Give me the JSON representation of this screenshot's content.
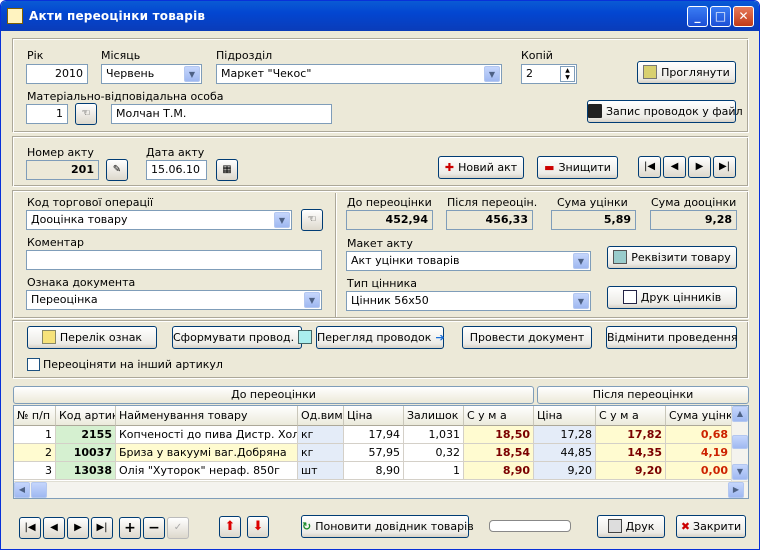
{
  "window": {
    "title": "Акти переоцінки товарів",
    "min": "_",
    "max": "□",
    "close": "✕"
  },
  "top": {
    "year_label": "Рік",
    "year": "2010",
    "month_label": "Місяць",
    "month": "Червень",
    "dept_label": "Підрозділ",
    "dept": "Маркет \"Чекос\"",
    "copies_label": "Копій",
    "copies": "2",
    "person_label": "Матеріально-відповідальна особа",
    "person_id": "1",
    "person_name": "Молчан Т.М.",
    "view_btn": "Проглянути",
    "save_btn": "Запис проводок у файл"
  },
  "act": {
    "number_label": "Номер акту",
    "number": "201",
    "date_label": "Дата акту",
    "date": "15.06.10",
    "new_btn": "Новий акт",
    "delete_btn": "Знищити"
  },
  "nav": {
    "first": "|◀",
    "prev": "◀",
    "next": "▶",
    "last": "▶|",
    "add": "+",
    "remove": "−",
    "up": "⬆",
    "down": "⬇",
    "apply": "✓"
  },
  "details": {
    "op_label": "Код торгової операції",
    "op": "Дооцінка товару",
    "comment_label": "Коментар",
    "comment": "",
    "doc_label": "Ознака документа",
    "doc": "Переоцінка",
    "before_label": "До переоцінки",
    "before": "452,94",
    "after_label": "Після переоцін.",
    "after": "456,33",
    "disc_label": "Сума уцінки",
    "disc": "5,89",
    "mark_label": "Сума дооцінки",
    "mark": "9,28",
    "layout_label": "Макет акту",
    "layout": "Акт уцінки товарів",
    "tag_label": "Тип цінника",
    "tag": "Цінник 56х50",
    "req_btn": "Реквізити товару",
    "print_tags_btn": "Друк цінників"
  },
  "actions": {
    "list_btn": "Перелік ознак",
    "form_btn": "Сформувати провод.",
    "view_btn": "Перегляд проводок",
    "post_btn": "Провести документ",
    "cancel_btn": "Відмінити проведення",
    "reassign_label": "Переоціняти на інший артикул"
  },
  "grid": {
    "group_before": "До переоцінки",
    "group_after": "Після переоцінки",
    "headers": [
      "№ п/п",
      "Код артик.",
      "Найменування товару",
      "Од.вим.",
      "Ціна",
      "Залишок",
      "С у м а",
      "Ціна",
      "С у м а",
      "Сума уцінки"
    ],
    "rows": [
      [
        "1",
        "2155",
        "Копченості до пива Дистр. Холо",
        "кг",
        "17,94",
        "1,031",
        "18,50",
        "17,28",
        "17,82",
        "0,68"
      ],
      [
        "2",
        "10037",
        "Бриза у вакуумі ваг.Добряна",
        "кг",
        "57,95",
        "0,32",
        "18,54",
        "44,85",
        "14,35",
        "4,19"
      ],
      [
        "3",
        "13038",
        "Олія \"Хуторок\" нераф. 850г",
        "шт",
        "8,90",
        "1",
        "8,90",
        "9,20",
        "9,20",
        "0,00"
      ]
    ]
  },
  "bottom": {
    "refresh_btn": "Поновити довідник товарів",
    "print_btn": "Друк",
    "close_btn": "Закрити"
  }
}
